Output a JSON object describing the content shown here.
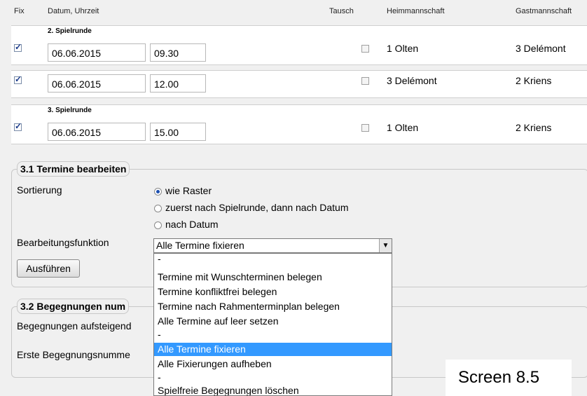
{
  "header": {
    "fix": "Fix",
    "datum": "Datum, Uhrzeit",
    "tausch": "Tausch",
    "heim": "Heimmannschaft",
    "gast": "Gastmannschaft"
  },
  "rounds": [
    {
      "label": "2. Spielrunde"
    },
    {
      "label": "3. Spielrunde"
    }
  ],
  "rows": [
    {
      "fix": true,
      "date": "06.06.2015",
      "time": "09.30",
      "tausch": false,
      "home": "1 Olten",
      "away": "3 Delémont"
    },
    {
      "fix": true,
      "date": "06.06.2015",
      "time": "12.00",
      "tausch": false,
      "home": "3 Delémont",
      "away": "2 Kriens"
    },
    {
      "fix": true,
      "date": "06.06.2015",
      "time": "15.00",
      "tausch": false,
      "home": "1 Olten",
      "away": "2 Kriens"
    }
  ],
  "section31": {
    "title": "3.1 Termine bearbeiten",
    "sort_label": "Sortierung",
    "sort_options": [
      "wie Raster",
      "zuerst nach Spielrunde, dann nach Datum",
      "nach Datum"
    ],
    "sort_selected": 0,
    "func_label": "Bearbeitungsfunktion",
    "func_value": "Alle Termine fixieren",
    "execute": "Ausführen"
  },
  "dropdown": {
    "options": [
      "-",
      "Termine mit Wunschterminen belegen",
      "Termine konfliktfrei belegen",
      "Termine nach Rahmenterminplan belegen",
      "Alle Termine auf leer setzen",
      "-",
      "Alle Termine fixieren",
      "Alle Fixierungen aufheben",
      "-",
      "Spielfreie Begegnungen löschen"
    ],
    "selected_index": 6
  },
  "section32": {
    "title": "3.2 Begegnungen num",
    "label1": "Begegnungen aufsteigend",
    "label2": "Erste Begegnungsnumme"
  },
  "caption": "Screen 8.5"
}
